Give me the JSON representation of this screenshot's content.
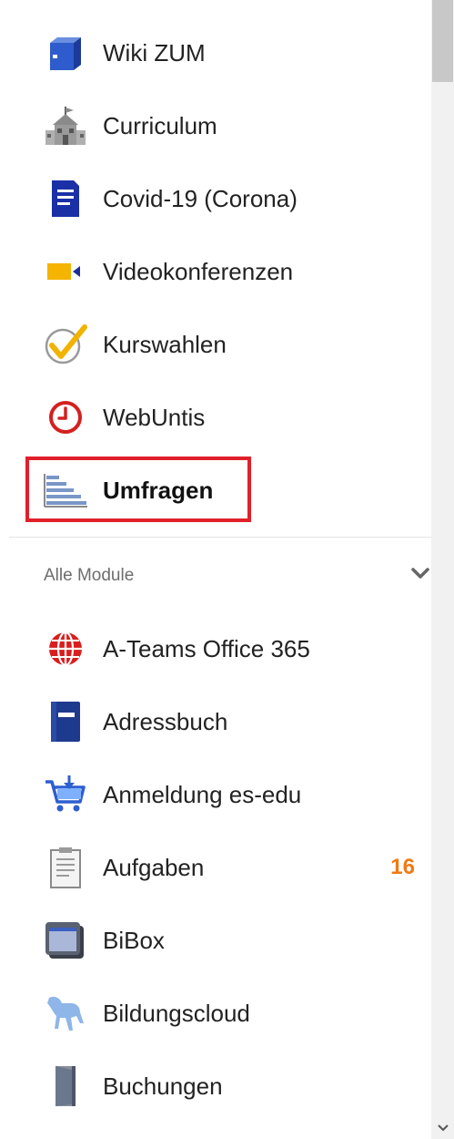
{
  "menu": {
    "top_items": [
      {
        "label": "Wiki ZUM",
        "icon": "book-icon"
      },
      {
        "label": "Curriculum",
        "icon": "school-building-icon"
      },
      {
        "label": "Covid-19 (Corona)",
        "icon": "document-icon"
      },
      {
        "label": "Videokonferenzen",
        "icon": "video-camera-icon"
      },
      {
        "label": "Kurswahlen",
        "icon": "checkmark-circle-icon"
      },
      {
        "label": "WebUntis",
        "icon": "clock-icon"
      },
      {
        "label": "Umfragen",
        "icon": "bar-chart-icon"
      }
    ],
    "section": {
      "label": "Alle Module",
      "icon": "chevron-down-icon"
    },
    "module_items": [
      {
        "label": "A-Teams Office 365",
        "icon": "globe-icon"
      },
      {
        "label": "Adressbuch",
        "icon": "address-book-icon"
      },
      {
        "label": "Anmeldung es-edu",
        "icon": "shopping-cart-icon"
      },
      {
        "label": "Aufgaben",
        "icon": "clipboard-icon",
        "badge": "16"
      },
      {
        "label": "BiBox",
        "icon": "window-box-icon"
      },
      {
        "label": "Bildungscloud",
        "icon": "horse-icon"
      },
      {
        "label": "Buchungen",
        "icon": "door-icon"
      }
    ]
  },
  "colors": {
    "highlight_border": "#e0202a",
    "badge": "#f07a12"
  }
}
